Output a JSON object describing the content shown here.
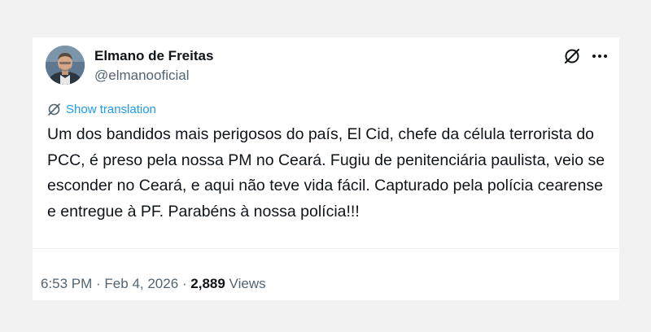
{
  "author": {
    "name": "Elmano de Freitas",
    "handle": "@elmanooficial"
  },
  "actions": {
    "grok_icon": "grok-icon",
    "more_icon": "more-icon"
  },
  "translation": {
    "label": "Show translation",
    "icon": "translate-icon"
  },
  "tweet": {
    "text": "Um dos bandidos mais perigosos do país, El Cid, chefe da célula terrorista do PCC, é preso pela nossa PM no Ceará. Fugiu de penitenciária paulista, veio se esconder no Ceará, e aqui não teve vida fácil. Capturado pela polícia cearense e entregue à PF. Parabéns à nossa polícia!!!"
  },
  "meta": {
    "time": "6:53 PM",
    "separator1": " · ",
    "date": "Feb 4, 2026",
    "separator2": " · ",
    "view_count": "2,889",
    "views_label": " Views"
  },
  "colors": {
    "accent": "#1d9bf0",
    "text": "#0f1419",
    "muted": "#536471",
    "background": "#f2f2f2"
  }
}
